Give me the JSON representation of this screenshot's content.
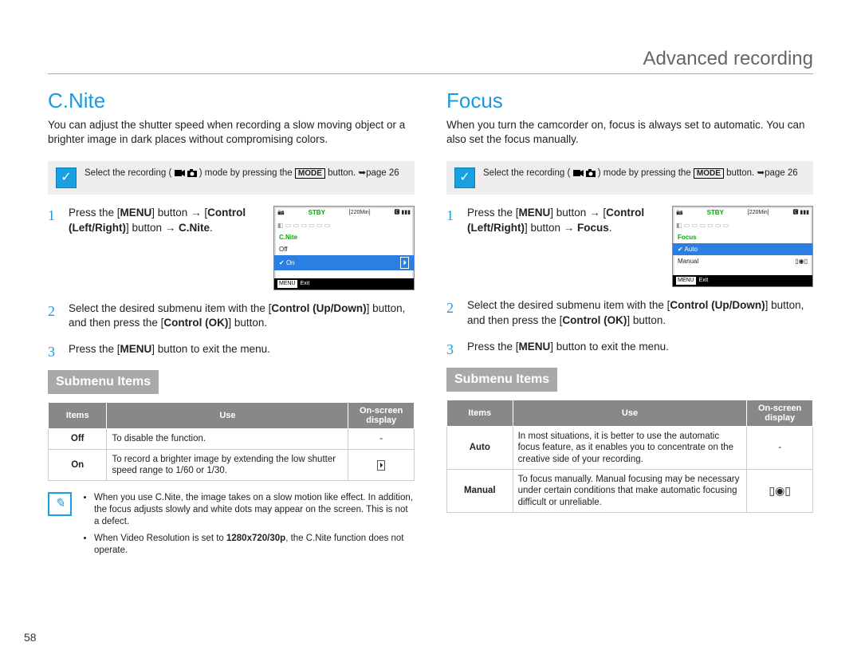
{
  "header": {
    "title": "Advanced recording"
  },
  "page_number": "58",
  "left": {
    "title": "C.Nite",
    "intro": "You can adjust the shutter speed when recording a slow moving object or a brighter image in dark places without compromising colors.",
    "select_pre": "Select the recording (",
    "select_post": ") mode by pressing the ",
    "select_button": "MODE",
    "select_tail": " button. ➥page 26",
    "steps": {
      "s1_a": "Press the [",
      "s1_menu": "MENU",
      "s1_b": "] button → [",
      "s1_ctrl": "Control (Left/Right)",
      "s1_c": "] button → ",
      "s1_target": "C.Nite",
      "s1_d": ".",
      "s2_a": "Select the desired submenu item with the [",
      "s2_ctrl": "Control (Up/Down)",
      "s2_b": "] button, and then press the [",
      "s2_ok": "Control (OK)",
      "s2_c": "] button.",
      "s3_a": "Press the [",
      "s3_menu": "MENU",
      "s3_b": "] button to exit the menu."
    },
    "screen": {
      "stby": "STBY",
      "time": "[220Min]",
      "menu": "C.Nite",
      "off": "Off",
      "on": "On",
      "exit": "Exit",
      "menu_box": "MENU"
    },
    "submenu_label": "Submenu Items",
    "tbl": {
      "h1": "Items",
      "h2": "Use",
      "h3": "On-screen display",
      "r1c1": "Off",
      "r1c2": "To disable the function.",
      "r1c3": "-",
      "r2c1": "On",
      "r2c2": "To record a brighter image by extending the low shutter speed range to 1/60 or 1/30.",
      "r2c3_icon": "cnite"
    },
    "notes": {
      "n1_a": "When you use C.Nite, the image takes on a slow motion like effect. In addition, the focus adjusts slowly and white dots may appear on the screen. This is not a defect.",
      "n2_a": "When Video Resolution is set to ",
      "n2_res": "1280x720/30p",
      "n2_b": ", the C.Nite function does not operate."
    }
  },
  "right": {
    "title": "Focus",
    "intro": "When you turn the camcorder on, focus is always set to automatic. You can also set the focus manually.",
    "select_pre": "Select the recording (",
    "select_post": ") mode by pressing the ",
    "select_button": "MODE",
    "select_tail": " button. ➥page 26",
    "steps": {
      "s1_a": "Press the [",
      "s1_menu": "MENU",
      "s1_b": "] button → [",
      "s1_ctrl": "Control (Left/Right)",
      "s1_c": "] button → ",
      "s1_target": "Focus",
      "s1_d": ".",
      "s2_a": "Select the desired submenu item with the [",
      "s2_ctrl": "Control (Up/Down)",
      "s2_b": "] button, and then press the [",
      "s2_ok": "Control (OK)",
      "s2_c": "] button.",
      "s3_a": "Press the [",
      "s3_menu": "MENU",
      "s3_b": "] button to exit the menu."
    },
    "screen": {
      "stby": "STBY",
      "time": "[220Min]",
      "menu": "Focus",
      "auto": "Auto",
      "manual": "Manual",
      "exit": "Exit",
      "menu_box": "MENU"
    },
    "submenu_label": "Submenu Items",
    "tbl": {
      "h1": "Items",
      "h2": "Use",
      "h3": "On-screen display",
      "r1c1": "Auto",
      "r1c2": "In most situations, it is better to use the automatic focus feature, as it enables you to concentrate on the creative side of your recording.",
      "r1c3": "-",
      "r2c1": "Manual",
      "r2c2": "To focus manually. Manual focusing may be necessary under certain conditions that make automatic focusing difficult or unreliable.",
      "r2c3_icon": "mf"
    }
  }
}
